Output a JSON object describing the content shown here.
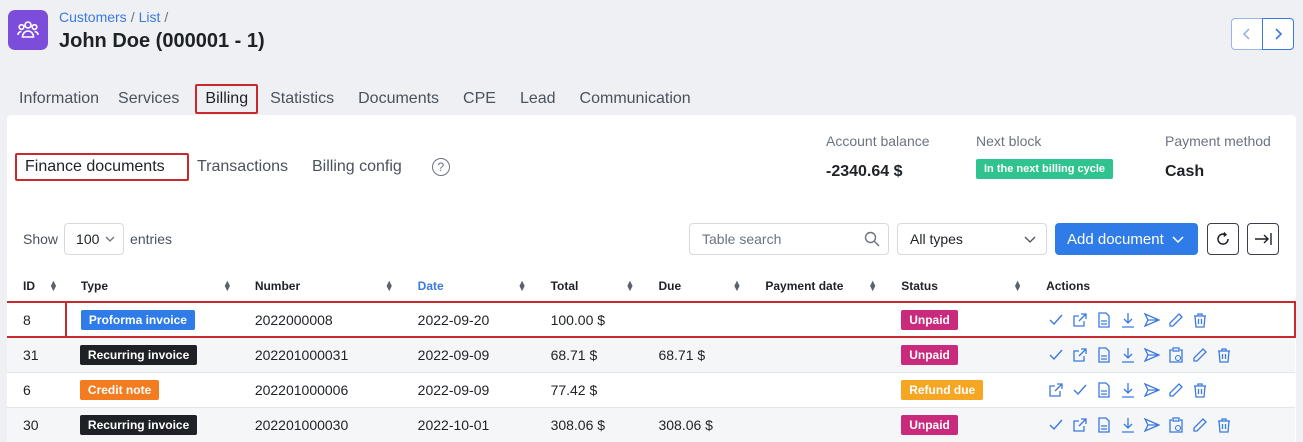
{
  "header": {
    "breadcrumb": [
      "Customers",
      "List"
    ],
    "title": "John Doe (000001 - 1)"
  },
  "main_tabs": [
    "Information",
    "Services",
    "Billing",
    "Statistics",
    "Documents",
    "CPE",
    "Lead",
    "Communication"
  ],
  "sub_tabs": [
    "Finance documents",
    "Transactions",
    "Billing config"
  ],
  "help_icon": "?",
  "summary": {
    "balance_label": "Account balance",
    "balance_value": "-2340.64 $",
    "next_block_label": "Next block",
    "next_block_value": "In the next billing cycle",
    "payment_label": "Payment method",
    "payment_value": "Cash"
  },
  "controls": {
    "show_label": "Show",
    "entries_value": "100",
    "entries_label": "entries",
    "search_placeholder": "Table search",
    "type_filter": "All types",
    "add_button": "Add document"
  },
  "table": {
    "columns": [
      "ID",
      "Type",
      "Number",
      "Date",
      "Total",
      "Due",
      "Payment date",
      "Status",
      "Actions"
    ],
    "rows": [
      {
        "id": "8",
        "type": "Proforma invoice",
        "type_color": "#2f7be8",
        "number": "2022000008",
        "date": "2022-09-20",
        "total": "100.00 $",
        "due": "",
        "payment_date": "",
        "status": "Unpaid",
        "status_color": "#c92a7c"
      },
      {
        "id": "31",
        "type": "Recurring invoice",
        "type_color": "#1e2226",
        "number": "202201000031",
        "date": "2022-09-09",
        "total": "68.71 $",
        "due": "68.71 $",
        "payment_date": "",
        "status": "Unpaid",
        "status_color": "#c92a7c"
      },
      {
        "id": "6",
        "type": "Credit note",
        "type_color": "#f47c20",
        "number": "202201000006",
        "date": "2022-09-09",
        "total": "77.42 $",
        "due": "",
        "payment_date": "",
        "status": "Refund due",
        "status_color": "#f5a623"
      },
      {
        "id": "30",
        "type": "Recurring invoice",
        "type_color": "#1e2226",
        "number": "202201000030",
        "date": "2022-10-01",
        "total": "308.06 $",
        "due": "308.06 $",
        "payment_date": "",
        "status": "Unpaid",
        "status_color": "#c92a7c"
      }
    ]
  },
  "colors": {
    "accent": "#2f7be8",
    "highlight_border": "#c8292c",
    "app_icon": "#7c4ddb"
  }
}
